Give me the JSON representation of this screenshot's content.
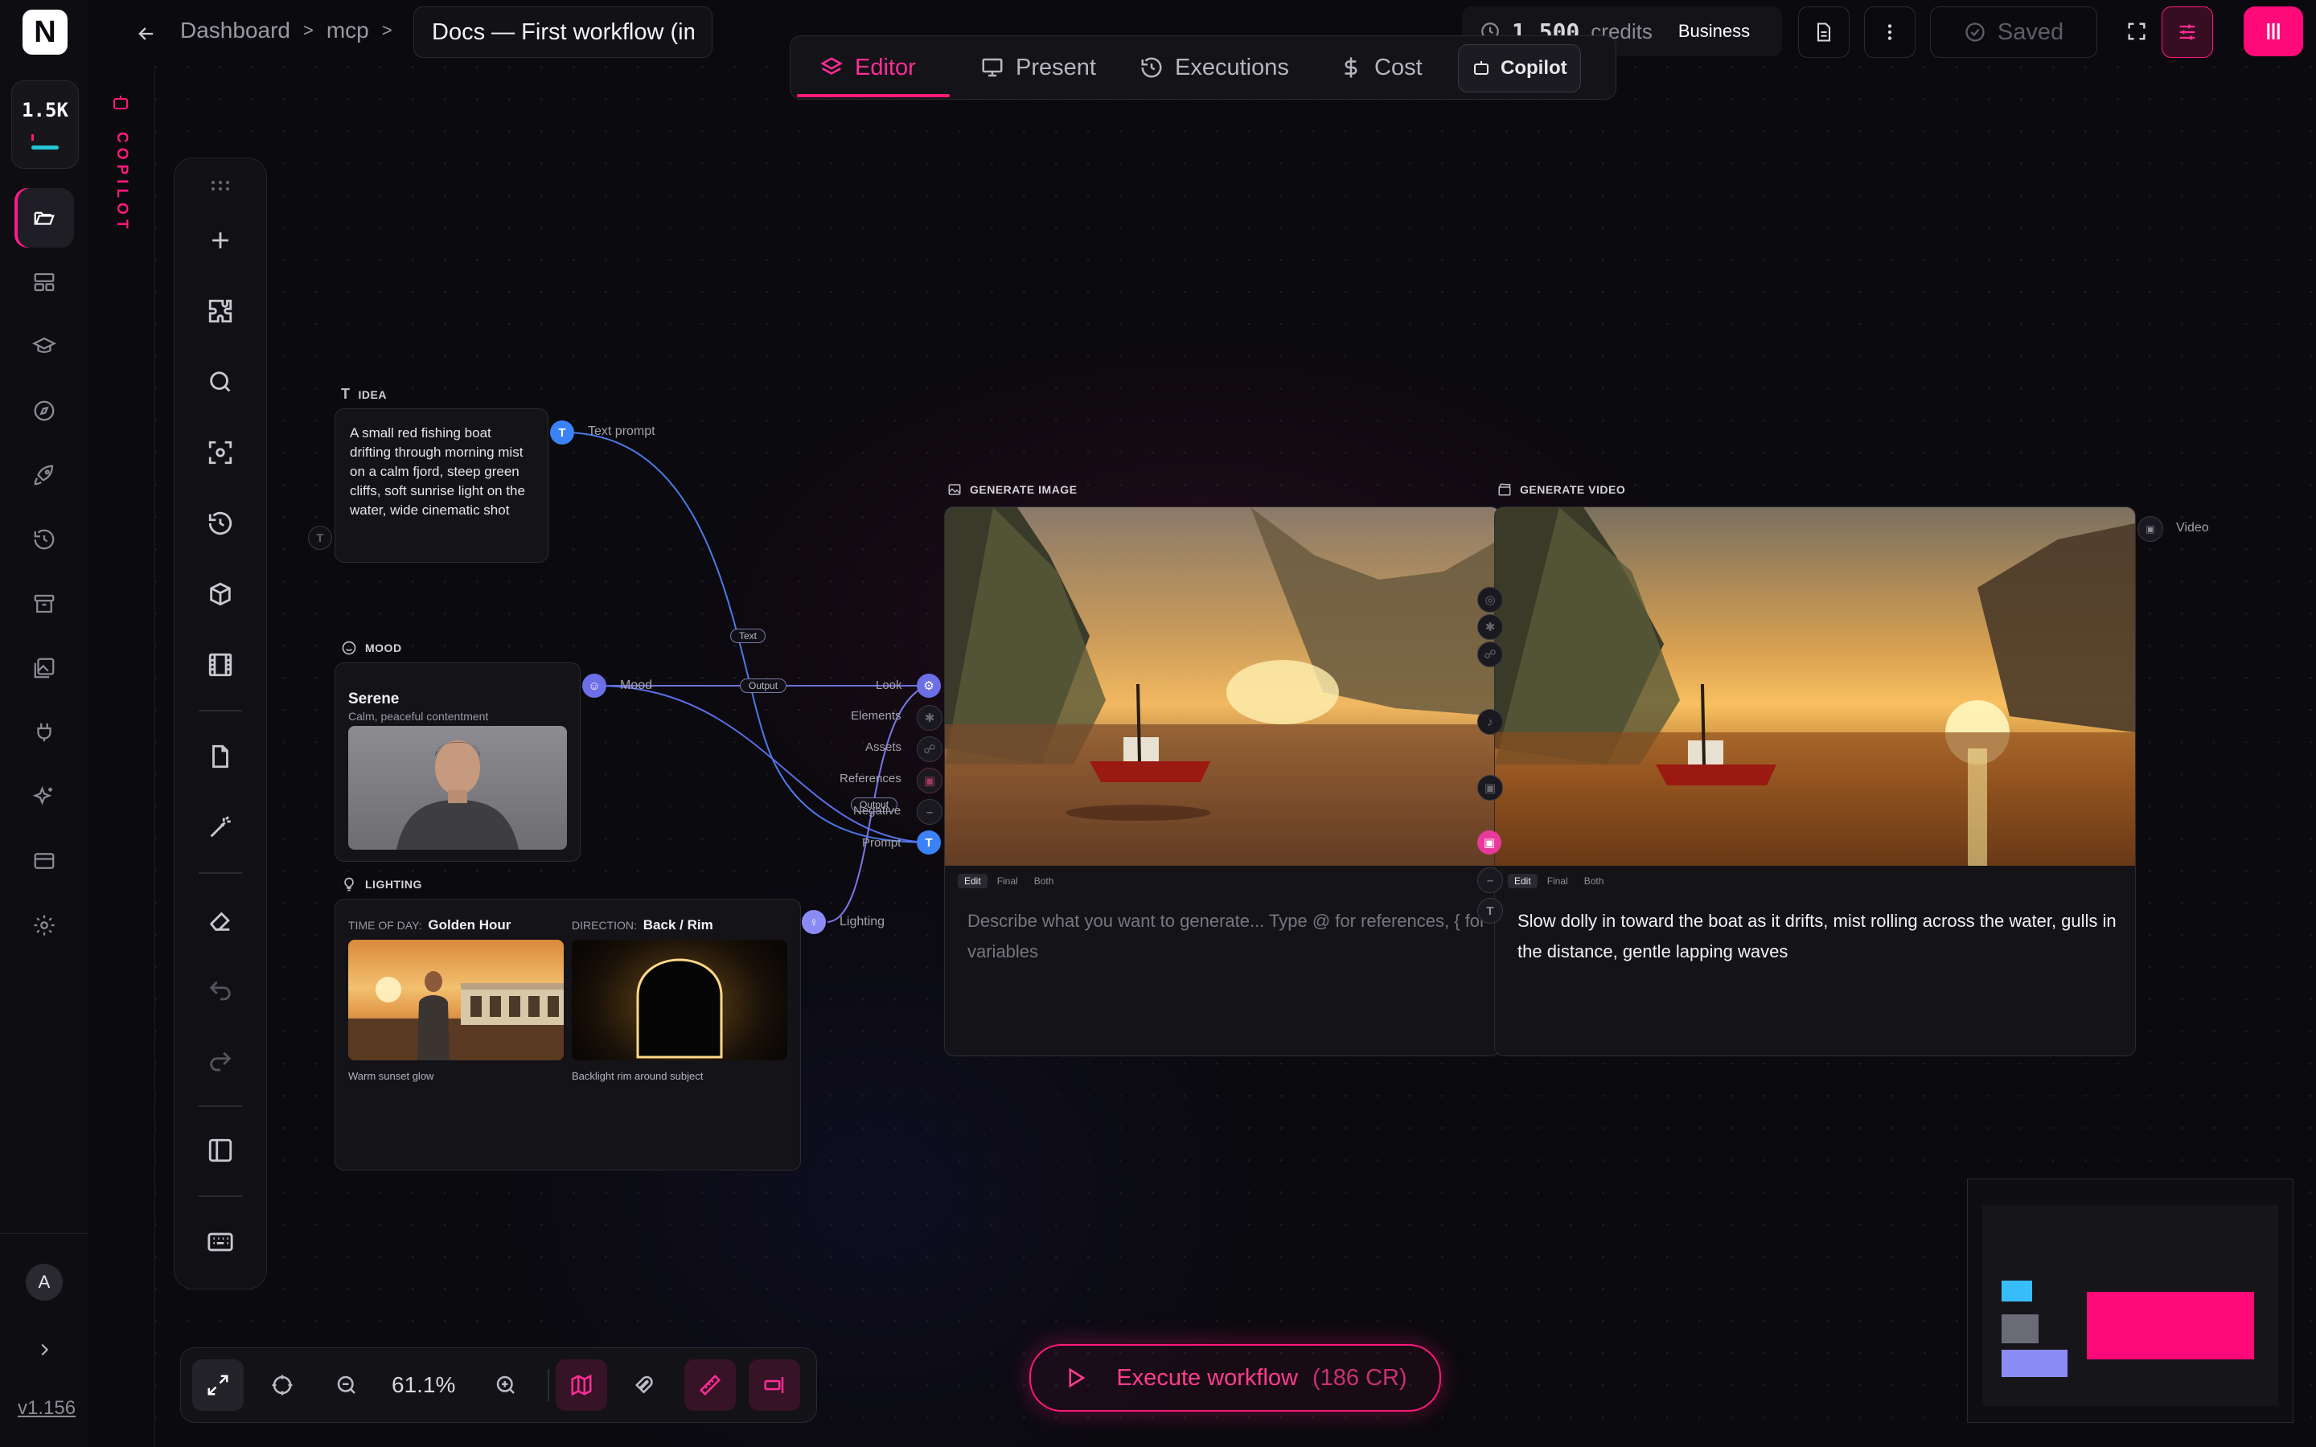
{
  "app": {
    "logo_letter": "N",
    "credits_badge": "1.5K",
    "version": "v1.156",
    "avatar_letter": "A"
  },
  "breadcrumb": {
    "items": [
      "Dashboard",
      "mcp"
    ],
    "separator": ">",
    "doc_title": "Docs — First workflow (im"
  },
  "top_right": {
    "credits_value": "1,500",
    "credits_label": "credits",
    "plan": "Business",
    "saved_label": "Saved"
  },
  "mode_tabs": [
    {
      "label": "Editor",
      "icon": "layers-icon",
      "active": true
    },
    {
      "label": "Present",
      "icon": "monitor-icon",
      "active": false
    },
    {
      "label": "Executions",
      "icon": "history-icon",
      "active": false
    },
    {
      "label": "Cost",
      "icon": "dollar-icon",
      "active": false
    },
    {
      "label": "Copilot",
      "icon": "robot-icon",
      "active": false
    }
  ],
  "copilot_strip_label": "COPILOT",
  "nodes": {
    "idea": {
      "title": "IDEA",
      "text": "A small red fishing boat drifting through morning mist on a calm fjord, steep green cliffs, soft sunrise light on the water, wide cinematic shot",
      "port_label": "Text prompt"
    },
    "mood": {
      "title": "MOOD",
      "name": "Serene",
      "desc": "Calm, peaceful contentment",
      "port_label": "Mood"
    },
    "lighting": {
      "title": "LIGHTING",
      "time_label": "TIME OF DAY:",
      "time_value": "Golden Hour",
      "time_caption": "Warm sunset glow",
      "dir_label": "DIRECTION:",
      "dir_value": "Back / Rim",
      "dir_caption": "Backlight rim around subject",
      "port_label": "Lighting"
    },
    "gen_image": {
      "title": "GENERATE IMAGE",
      "inputs": [
        "Look",
        "Elements",
        "Assets",
        "References",
        "Negative",
        "Prompt"
      ],
      "tabs": [
        "Edit",
        "Final",
        "Both"
      ],
      "prompt_placeholder": "Describe what you want to generate... Type @ for references, { for variables"
    },
    "gen_video": {
      "title": "GENERATE VIDEO",
      "tabs": [
        "Edit",
        "Final",
        "Both"
      ],
      "prompt_text": "Slow dolly in toward the boat as it drifts, mist rolling across the water, gulls in the distance, gentle lapping waves",
      "output_label": "Video"
    }
  },
  "edge_pills": {
    "text": "Text",
    "output1": "Output",
    "output2": "Output"
  },
  "zoom": {
    "level": "61.1%"
  },
  "execute": {
    "label": "Execute workflow",
    "cost": "(186 CR)"
  },
  "colors": {
    "accent": "#ff1a7a",
    "port_blue": "#3b82f6",
    "port_violet": "#7c7cf0",
    "minimap_cyan": "#38bdf8",
    "minimap_gray": "#6b6b78",
    "minimap_violet": "#8b8bf5",
    "minimap_pink": "#ff0a78"
  }
}
